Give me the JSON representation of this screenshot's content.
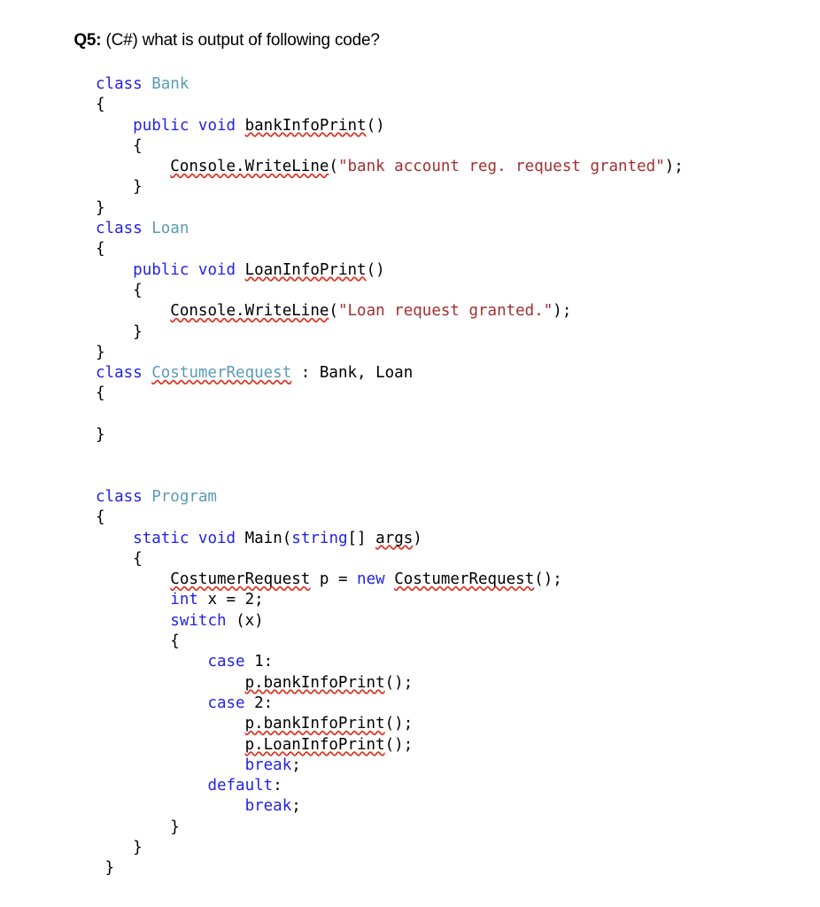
{
  "question": {
    "label": "Q5:",
    "text": " (C#) what is output of following code?"
  },
  "colors": {
    "keyword": "#2222E8",
    "type_name": "#5B9BB5",
    "string_literal": "#A33030",
    "plain_text": "#000000",
    "spellcheck_underline": "#E03020",
    "background": "#FFFFFF"
  },
  "code": {
    "language": "C#",
    "lines": [
      {
        "id": "l01",
        "indent": 0,
        "tokens": [
          {
            "t": "class ",
            "c": "kw"
          },
          {
            "t": "Bank",
            "c": "type"
          }
        ]
      },
      {
        "id": "l02",
        "indent": 0,
        "tokens": [
          {
            "t": "{",
            "c": "plain"
          }
        ]
      },
      {
        "id": "l03",
        "indent": 1,
        "tokens": [
          {
            "t": "public ",
            "c": "kw"
          },
          {
            "t": "void ",
            "c": "kw"
          },
          {
            "t": "bankInfoPrint",
            "c": "plain",
            "squiggle": true
          },
          {
            "t": "()",
            "c": "plain"
          }
        ]
      },
      {
        "id": "l04",
        "indent": 1,
        "tokens": [
          {
            "t": "{",
            "c": "plain"
          }
        ]
      },
      {
        "id": "l05",
        "indent": 2,
        "tokens": [
          {
            "t": "Console.WriteLine",
            "c": "plain",
            "squiggle": true
          },
          {
            "t": "(",
            "c": "plain"
          },
          {
            "t": "\"bank account reg. request granted\"",
            "c": "str"
          },
          {
            "t": ");",
            "c": "plain"
          }
        ]
      },
      {
        "id": "l06",
        "indent": 1,
        "tokens": [
          {
            "t": "}",
            "c": "plain"
          }
        ]
      },
      {
        "id": "l07",
        "indent": 0,
        "tokens": [
          {
            "t": "}",
            "c": "plain"
          }
        ]
      },
      {
        "id": "l08",
        "indent": 0,
        "tokens": [
          {
            "t": "class ",
            "c": "kw"
          },
          {
            "t": "Loan",
            "c": "type"
          }
        ]
      },
      {
        "id": "l09",
        "indent": 0,
        "tokens": [
          {
            "t": "{",
            "c": "plain"
          }
        ]
      },
      {
        "id": "l10",
        "indent": 1,
        "tokens": [
          {
            "t": "public ",
            "c": "kw"
          },
          {
            "t": "void ",
            "c": "kw"
          },
          {
            "t": "LoanInfoPrint",
            "c": "plain",
            "squiggle": true
          },
          {
            "t": "()",
            "c": "plain"
          }
        ]
      },
      {
        "id": "l11",
        "indent": 1,
        "tokens": [
          {
            "t": "{",
            "c": "plain"
          }
        ]
      },
      {
        "id": "l12",
        "indent": 2,
        "tokens": [
          {
            "t": "Console.WriteLine",
            "c": "plain",
            "squiggle": true
          },
          {
            "t": "(",
            "c": "plain"
          },
          {
            "t": "\"Loan request granted.\"",
            "c": "str"
          },
          {
            "t": ");",
            "c": "plain"
          }
        ]
      },
      {
        "id": "l13",
        "indent": 1,
        "tokens": [
          {
            "t": "}",
            "c": "plain"
          }
        ]
      },
      {
        "id": "l14",
        "indent": 0,
        "tokens": [
          {
            "t": "}",
            "c": "plain"
          }
        ]
      },
      {
        "id": "l15",
        "indent": 0,
        "tokens": [
          {
            "t": "class ",
            "c": "kw"
          },
          {
            "t": "CostumerRequest",
            "c": "type",
            "squiggle": true
          },
          {
            "t": " : Bank, Loan",
            "c": "plain"
          }
        ]
      },
      {
        "id": "l16",
        "indent": 0,
        "tokens": [
          {
            "t": "{",
            "c": "plain"
          }
        ]
      },
      {
        "id": "l17",
        "indent": 0,
        "tokens": []
      },
      {
        "id": "l18",
        "indent": 0,
        "tokens": [
          {
            "t": "}",
            "c": "plain"
          }
        ]
      },
      {
        "id": "l19",
        "indent": 0,
        "tokens": []
      },
      {
        "id": "l20",
        "indent": 0,
        "tokens": []
      },
      {
        "id": "l21",
        "indent": 0,
        "tokens": [
          {
            "t": "class ",
            "c": "kw"
          },
          {
            "t": "Program",
            "c": "type"
          }
        ]
      },
      {
        "id": "l22",
        "indent": 0,
        "tokens": [
          {
            "t": "{",
            "c": "plain"
          }
        ]
      },
      {
        "id": "l23",
        "indent": 1,
        "tokens": [
          {
            "t": "static ",
            "c": "kw"
          },
          {
            "t": "void ",
            "c": "kw"
          },
          {
            "t": "Main(",
            "c": "plain"
          },
          {
            "t": "string",
            "c": "kw"
          },
          {
            "t": "[] ",
            "c": "plain"
          },
          {
            "t": "args",
            "c": "plain",
            "squiggle": true
          },
          {
            "t": ")",
            "c": "plain"
          }
        ]
      },
      {
        "id": "l24",
        "indent": 1,
        "tokens": [
          {
            "t": "{",
            "c": "plain"
          }
        ]
      },
      {
        "id": "l25",
        "indent": 2,
        "tokens": [
          {
            "t": "CostumerRequest",
            "c": "plain",
            "squiggle": true
          },
          {
            "t": " p = ",
            "c": "plain"
          },
          {
            "t": "new ",
            "c": "kw"
          },
          {
            "t": "CostumerRequest",
            "c": "plain",
            "squiggle": true
          },
          {
            "t": "();",
            "c": "plain"
          }
        ]
      },
      {
        "id": "l26",
        "indent": 2,
        "tokens": [
          {
            "t": "int ",
            "c": "kw"
          },
          {
            "t": "x = 2;",
            "c": "plain"
          }
        ]
      },
      {
        "id": "l27",
        "indent": 2,
        "tokens": [
          {
            "t": "switch ",
            "c": "kw"
          },
          {
            "t": "(x)",
            "c": "plain"
          }
        ]
      },
      {
        "id": "l28",
        "indent": 2,
        "tokens": [
          {
            "t": "{",
            "c": "plain"
          }
        ]
      },
      {
        "id": "l29",
        "indent": 3,
        "tokens": [
          {
            "t": "case ",
            "c": "kw"
          },
          {
            "t": "1:",
            "c": "plain"
          }
        ]
      },
      {
        "id": "l30",
        "indent": 4,
        "tokens": [
          {
            "t": "p.bankInfoPrint",
            "c": "plain",
            "squiggle": true
          },
          {
            "t": "();",
            "c": "plain"
          }
        ]
      },
      {
        "id": "l31",
        "indent": 3,
        "tokens": [
          {
            "t": "case ",
            "c": "kw"
          },
          {
            "t": "2:",
            "c": "plain"
          }
        ]
      },
      {
        "id": "l32",
        "indent": 4,
        "tokens": [
          {
            "t": "p.bankInfoPrint",
            "c": "plain",
            "squiggle": true
          },
          {
            "t": "();",
            "c": "plain"
          }
        ]
      },
      {
        "id": "l33",
        "indent": 4,
        "tokens": [
          {
            "t": "p.LoanInfoPrint",
            "c": "plain",
            "squiggle": true
          },
          {
            "t": "();",
            "c": "plain"
          }
        ]
      },
      {
        "id": "l34",
        "indent": 4,
        "tokens": [
          {
            "t": "break",
            "c": "kw"
          },
          {
            "t": ";",
            "c": "plain"
          }
        ]
      },
      {
        "id": "l35",
        "indent": 3,
        "tokens": [
          {
            "t": "default",
            "c": "kw"
          },
          {
            "t": ":",
            "c": "plain"
          }
        ]
      },
      {
        "id": "l36",
        "indent": 4,
        "tokens": [
          {
            "t": "break",
            "c": "kw"
          },
          {
            "t": ";",
            "c": "plain"
          }
        ]
      },
      {
        "id": "l37",
        "indent": 2,
        "tokens": [
          {
            "t": "}",
            "c": "plain"
          }
        ]
      },
      {
        "id": "l38",
        "indent": 1,
        "tokens": [
          {
            "t": "}",
            "c": "plain"
          }
        ]
      },
      {
        "id": "l39",
        "indent": 0,
        "tokens": [
          {
            "t": " }",
            "c": "plain"
          }
        ]
      }
    ]
  }
}
